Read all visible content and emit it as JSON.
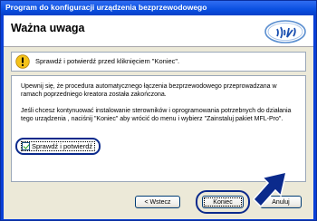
{
  "window": {
    "title": "Program do konfiguracji urządzenia bezprzewodowego"
  },
  "header": {
    "title": "Ważna uwaga",
    "logo_icon": "wifi-icon"
  },
  "warning": {
    "icon": "warning-icon",
    "text": "Sprawdź i potwierdź przed kliknięciem \"Koniec\"."
  },
  "content": {
    "paragraph1": "Upewnij się, że procedura automatycznego łączenia bezprzewodowego przeprowadzana w ramach poprzedniego kreatora została zakończona.",
    "paragraph2": "Jeśli chcesz kontynuować instalowanie sterowników i oprogramowania potrzebnych do działania tego urządzenia , naciśnij \"Koniec\" aby wrócić do menu i wybierz \"Zainstaluj pakiet MFL-Pro\".",
    "checkbox_label": "Sprawdź i potwierdź",
    "checkbox_checked": true
  },
  "buttons": {
    "back": "< Wstecz",
    "finish": "Koniec",
    "cancel": "Anuluj"
  },
  "colors": {
    "title_bar": "#0a4fe0",
    "annotation": "#0b2a8c",
    "dialog_bg": "#ece9d8"
  }
}
